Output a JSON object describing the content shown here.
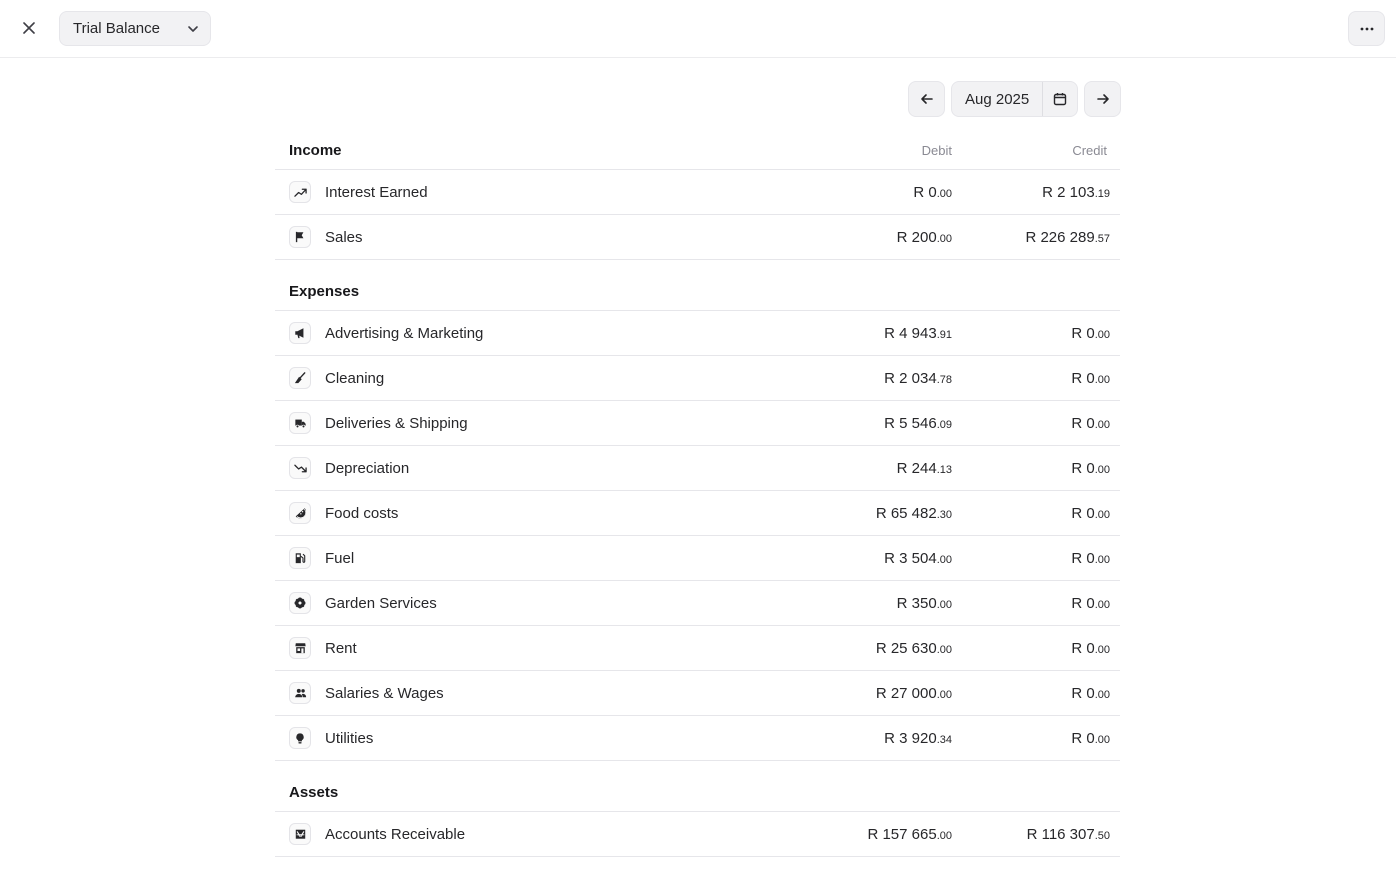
{
  "header": {
    "report_select_label": "Trial Balance",
    "close_icon": "close-icon",
    "chevron_icon": "chevron-down-icon",
    "more_icon": "more-horizontal-icon"
  },
  "period": {
    "label": "Aug 2025",
    "prev_icon": "arrow-left-icon",
    "next_icon": "arrow-right-icon",
    "calendar_icon": "calendar-icon"
  },
  "columns": {
    "debit": "Debit",
    "credit": "Credit"
  },
  "sections": {
    "income": {
      "title": "Income",
      "rows": [
        {
          "name": "Interest Earned",
          "icon": "trending-up-icon",
          "debit_main": "R 0",
          "debit_cents": ".00",
          "credit_main": "R 2 103",
          "credit_cents": ".19"
        },
        {
          "name": "Sales",
          "icon": "flag-icon",
          "debit_main": "R 200",
          "debit_cents": ".00",
          "credit_main": "R 226 289",
          "credit_cents": ".57"
        }
      ]
    },
    "expenses": {
      "title": "Expenses",
      "rows": [
        {
          "name": "Advertising & Marketing",
          "icon": "megaphone-icon",
          "debit_main": "R 4 943",
          "debit_cents": ".91",
          "credit_main": "R 0",
          "credit_cents": ".00"
        },
        {
          "name": "Cleaning",
          "icon": "broom-icon",
          "debit_main": "R 2 034",
          "debit_cents": ".78",
          "credit_main": "R 0",
          "credit_cents": ".00"
        },
        {
          "name": "Deliveries & Shipping",
          "icon": "truck-icon",
          "debit_main": "R 5 546",
          "debit_cents": ".09",
          "credit_main": "R 0",
          "credit_cents": ".00"
        },
        {
          "name": "Depreciation",
          "icon": "trending-down-icon",
          "debit_main": "R 244",
          "debit_cents": ".13",
          "credit_main": "R 0",
          "credit_cents": ".00"
        },
        {
          "name": "Food costs",
          "icon": "watermelon-icon",
          "debit_main": "R 65 482",
          "debit_cents": ".30",
          "credit_main": "R 0",
          "credit_cents": ".00"
        },
        {
          "name": "Fuel",
          "icon": "fuel-pump-icon",
          "debit_main": "R 3 504",
          "debit_cents": ".00",
          "credit_main": "R 0",
          "credit_cents": ".00"
        },
        {
          "name": "Garden Services",
          "icon": "flower-icon",
          "debit_main": "R 350",
          "debit_cents": ".00",
          "credit_main": "R 0",
          "credit_cents": ".00"
        },
        {
          "name": "Rent",
          "icon": "storefront-icon",
          "debit_main": "R 25 630",
          "debit_cents": ".00",
          "credit_main": "R 0",
          "credit_cents": ".00"
        },
        {
          "name": "Salaries & Wages",
          "icon": "users-icon",
          "debit_main": "R 27 000",
          "debit_cents": ".00",
          "credit_main": "R 0",
          "credit_cents": ".00"
        },
        {
          "name": "Utilities",
          "icon": "lightbulb-icon",
          "debit_main": "R 3 920",
          "debit_cents": ".34",
          "credit_main": "R 0",
          "credit_cents": ".00"
        }
      ]
    },
    "assets": {
      "title": "Assets",
      "rows": [
        {
          "name": "Accounts Receivable",
          "icon": "inbox-icon",
          "debit_main": "R 157 665",
          "debit_cents": ".00",
          "credit_main": "R 116 307",
          "credit_cents": ".50"
        }
      ]
    }
  }
}
